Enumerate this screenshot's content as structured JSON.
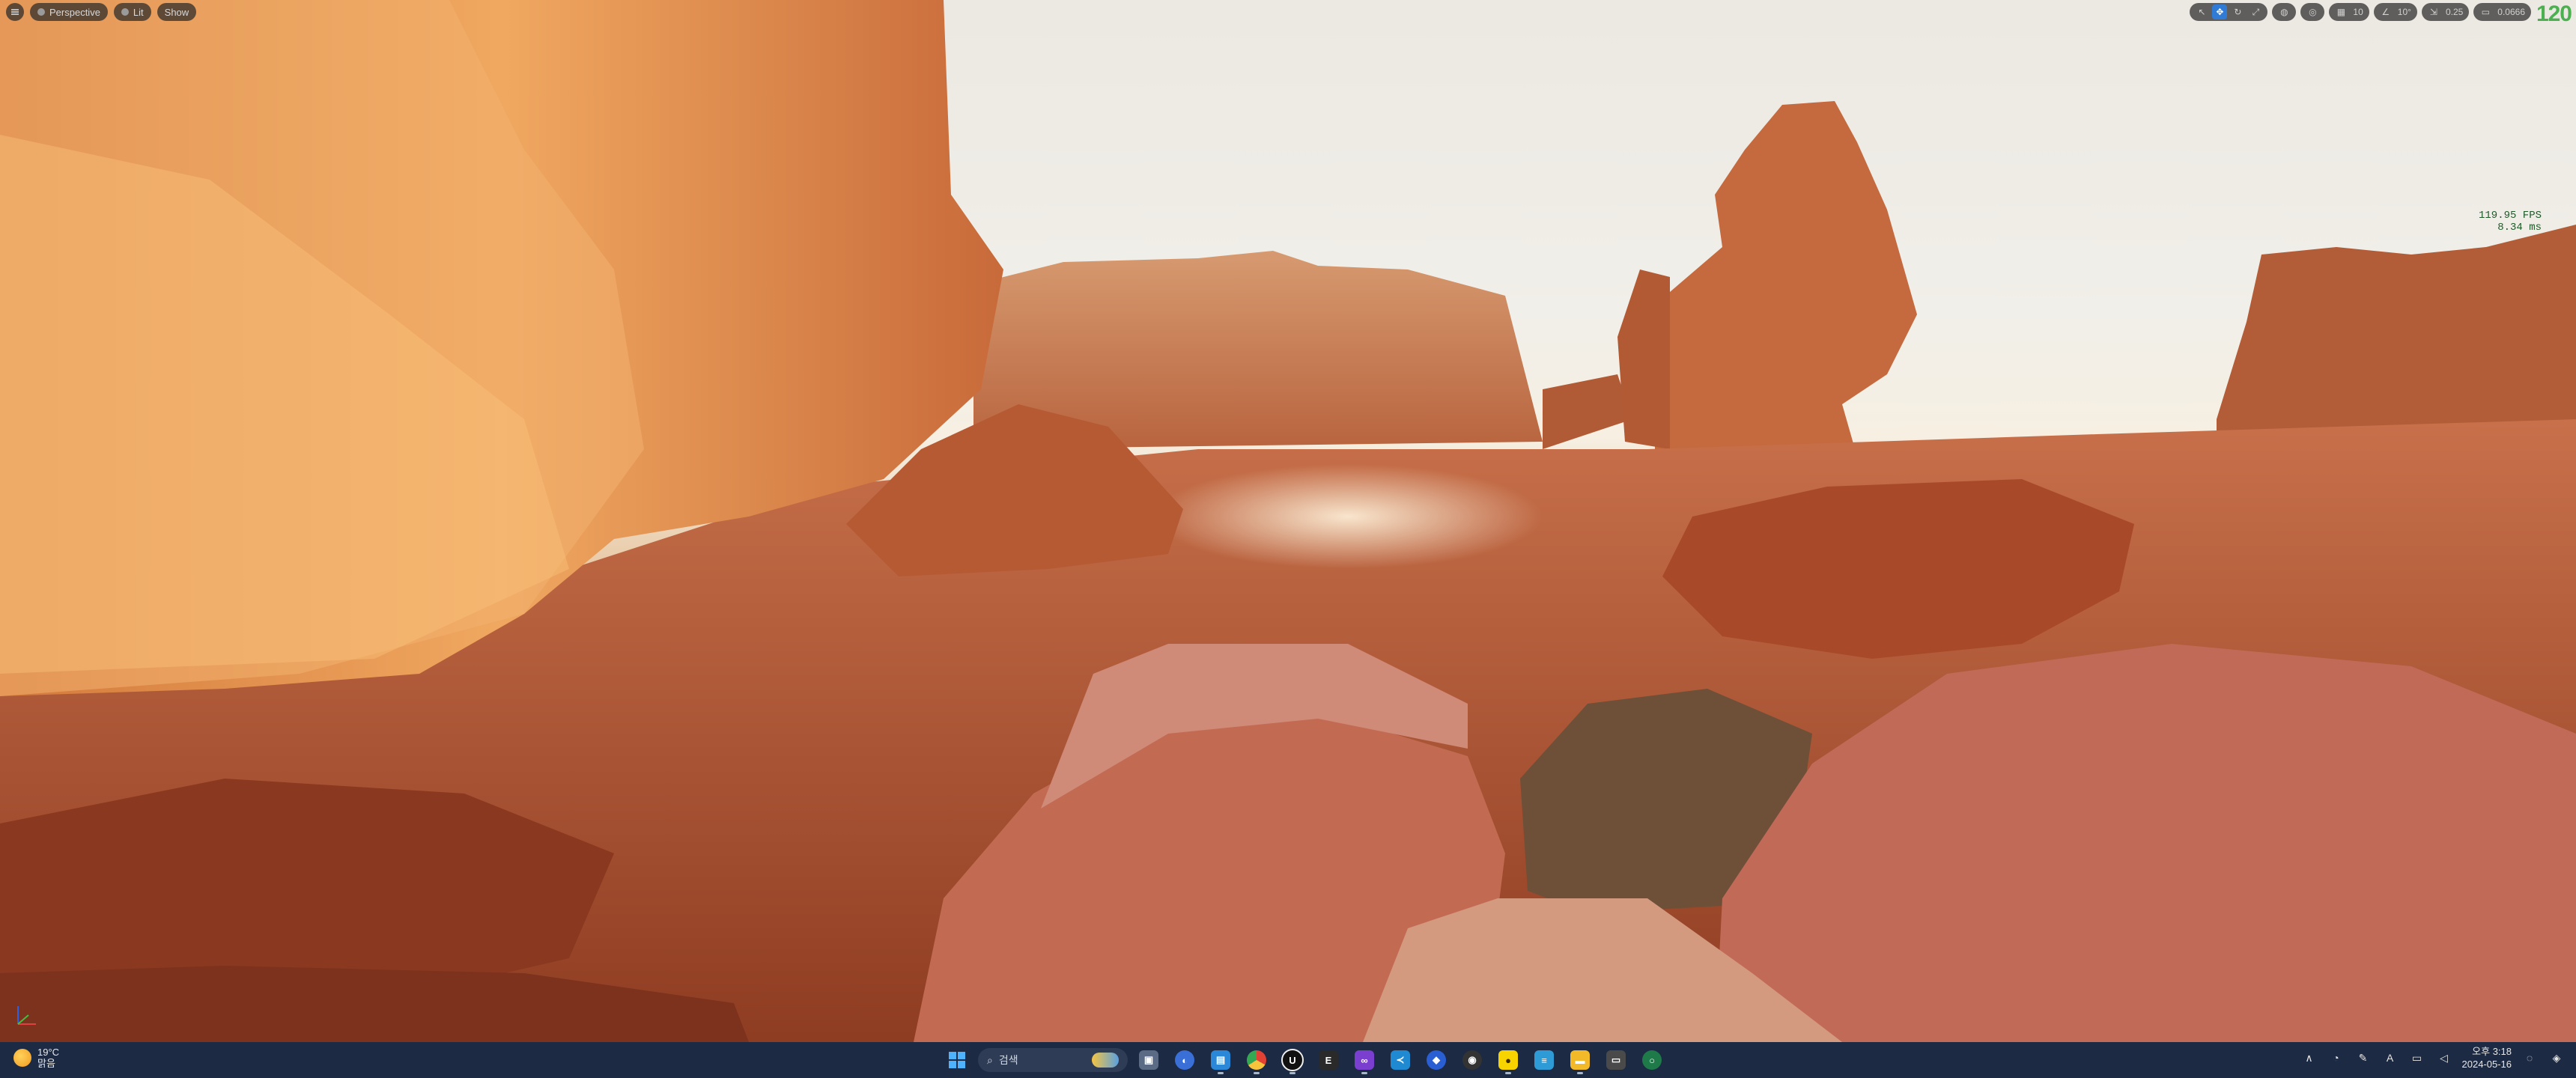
{
  "viewport": {
    "view_mode_label": "Perspective",
    "lit_label": "Lit",
    "show_label": "Show",
    "snap_angle": "10°",
    "grid_size": "10",
    "scale_snap": "0.25",
    "camera_speed": "0.0666",
    "perf_counter": "120",
    "fps_text": "119.95 FPS",
    "ms_text": "8.34 ms"
  },
  "taskbar": {
    "weather_temp": "19°C",
    "weather_desc": "맑음",
    "search_placeholder": "검색",
    "time": "오후 3:18",
    "date": "2024-05-16",
    "ime_label": "A"
  }
}
